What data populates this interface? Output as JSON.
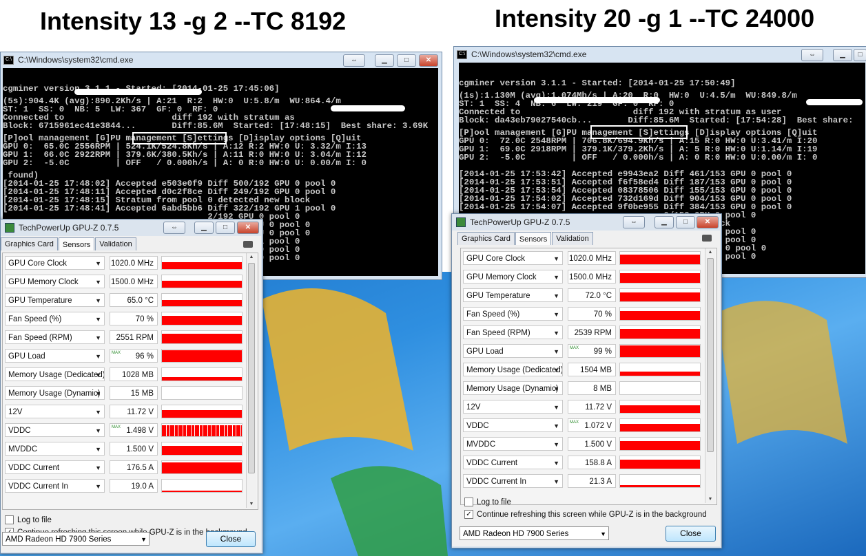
{
  "headings": {
    "left": "Intensity 13 -g 2 --TC 8192",
    "right": "Intensity 20 -g 1 --TC 24000"
  },
  "colors": {
    "graph_red": "#ff0000",
    "console_bg": "#000000",
    "console_text": "#c8c8c8"
  },
  "left_cmd": {
    "title": "C:\\Windows\\system32\\cmd.exe",
    "lines": [
      "cgminer version 3.1.1 - Started: [2014-01-25 17:45:06]",
      "",
      "(5s):904.4K (avg):890.2Kh/s | A:21  R:2  HW:0  U:5.8/m  WU:864.4/m",
      "ST: 1  SS: 0  NB: 5  LW: 367  GF: 0  RF: 0",
      "Connected to                     diff 192 with stratum as",
      "Block: 6715961ec41e3844...       Diff:85.6M  Started: [17:48:15]  Best share: 3.69K",
      "",
      "[P]ool management [G]PU management [S]ettings [D]isplay options [Q]uit",
      "GPU 0:  65.0C 2556RPM | 524.1K/524.8Kh/s | A:12 R:2 HW:0 U: 3.32/m I:13",
      "GPU 1:  66.0C 2922RPM | 379.6K/380.5Kh/s | A:11 R:0 HW:0 U: 3.04/m I:12",
      "GPU 2:  -5.0C         | OFF   / 0.000h/s | A: 0 R:0 HW:0 U: 0.00/m I: 0",
      "",
      " found)",
      "[2014-01-25 17:48:02] Accepted e503e0f9 Diff 500/192 GPU 0 pool 0",
      "[2014-01-25 17:48:11] Accepted d0c2f8ce Diff 249/192 GPU 0 pool 0",
      "[2014-01-25 17:48:15] Stratum from pool 0 detected new block",
      "[2014-01-25 17:48:41] Accepted 6abd5bb6 Diff 322/192 GPU 1 pool 0",
      "                                        2/192 GPU 0 pool 0",
      "                                        69K/192 GPU 0 pool 0",
      "                                        97K/192 GPU 0 pool 0",
      "                                        8/192 GPU 1 pool 0",
      "                                        8/192 GPU 0 pool 0",
      "                                        4/192 GPU 0 pool 0"
    ]
  },
  "right_cmd": {
    "title": "C:\\Windows\\system32\\cmd.exe",
    "lines": [
      "cgminer version 3.1.1 - Started: [2014-01-25 17:50:49]",
      "",
      "(1s):1.130M (avg):1.074Mh/s | A:20  R:0  HW:0  U:4.5/m  WU:849.8/m",
      "ST: 1  SS: 4  NB: 6  LW: 219  GF: 0  RF: 0",
      "Connected to                      diff 192 with stratum as user",
      "Block: da43eb79027540cb...       Diff:85.6M  Started: [17:54:28]  Best share:",
      "",
      "[P]ool management [G]PU management [S]ettings [D]isplay options [Q]uit",
      "GPU 0:  72.0C 2548RPM | 706.8K/694.9Kh/s | A:15 R:0 HW:0 U:3.41/m I:20",
      "GPU 1:  69.0C 2918RPM | 379.1K/379.2Kh/s | A: 5 R:0 HW:0 U:1.14/m I:19",
      "GPU 2:  -5.0C         | OFF   / 0.000h/s | A: 0 R:0 HW:0 U:0.00/m I: 0",
      "",
      "",
      "[2014-01-25 17:53:42] Accepted e9943ea2 Diff 461/153 GPU 0 pool 0",
      "[2014-01-25 17:53:51] Accepted f6f58ed4 Diff 187/153 GPU 0 pool 0",
      "[2014-01-25 17:53:54] Accepted 08378506 Diff 155/153 GPU 0 pool 0",
      "[2014-01-25 17:54:02] Accepted 732d169d Diff 904/153 GPU 0 pool 0",
      "[2014-01-25 17:54:07] Accepted 9f0be955 Diff 384/153 GPU 0 pool 0",
      "                                        0/153 GPU 0 pool 0",
      "                                        ted new block",
      "                                        6/153 GPU 0 pool 0",
      "                                        8/153 GPU 0 pool 0",
      "                                        38K/192 GPU 0 pool 0",
      "                                        0/192 GPU 0 pool 0"
    ]
  },
  "left_gpuz": {
    "title": "TechPowerUp GPU-Z 0.7.5",
    "tabs": [
      "Graphics Card",
      "Sensors",
      "Validation"
    ],
    "sensors": [
      {
        "name": "GPU Core Clock",
        "value": "1020.0 MHz",
        "max": "",
        "level": 0.55
      },
      {
        "name": "GPU Memory Clock",
        "value": "1500.0 MHz",
        "max": "",
        "level": 0.55
      },
      {
        "name": "GPU Temperature",
        "value": "65.0 °C",
        "max": "",
        "level": 0.5
      },
      {
        "name": "Fan Speed (%)",
        "value": "70 %",
        "max": "",
        "level": 0.7
      },
      {
        "name": "Fan Speed (RPM)",
        "value": "2551 RPM",
        "max": "",
        "level": 0.8
      },
      {
        "name": "GPU Load",
        "value": "96 %",
        "max": "MAX",
        "level": 0.95
      },
      {
        "name": "Memory Usage (Dedicated)",
        "value": "1028 MB",
        "max": "",
        "level": 0.3
      },
      {
        "name": "Memory Usage (Dynamic)",
        "value": "15 MB",
        "max": "",
        "level": 0
      },
      {
        "name": "12V",
        "value": "11.72 V",
        "max": "",
        "level": 0.6
      },
      {
        "name": "VDDC",
        "value": "1.498 V",
        "max": "MAX",
        "level": 0.9
      },
      {
        "name": "MVDDC",
        "value": "1.500 V",
        "max": "",
        "level": 0.7
      },
      {
        "name": "VDDC Current",
        "value": "176.5 A",
        "max": "",
        "level": 0.9
      },
      {
        "name": "VDDC Current In",
        "value": "19.0 A",
        "max": "",
        "level": 0.1
      }
    ],
    "log_label": "Log to file",
    "refresh_label": "Continue refreshing this screen while GPU-Z is in the background",
    "device": "AMD Radeon HD 7900 Series",
    "close_label": "Close"
  },
  "right_gpuz": {
    "title": "TechPowerUp GPU-Z 0.7.5",
    "tabs": [
      "Graphics Card",
      "Sensors",
      "Validation"
    ],
    "sensors": [
      {
        "name": "GPU Core Clock",
        "value": "1020.0 MHz",
        "max": "",
        "level": 0.8
      },
      {
        "name": "GPU Memory Clock",
        "value": "1500.0 MHz",
        "max": "",
        "level": 0.8
      },
      {
        "name": "GPU Temperature",
        "value": "72.0 °C",
        "max": "",
        "level": 0.75
      },
      {
        "name": "Fan Speed (%)",
        "value": "70 %",
        "max": "",
        "level": 0.7
      },
      {
        "name": "Fan Speed (RPM)",
        "value": "2539 RPM",
        "max": "",
        "level": 0.8
      },
      {
        "name": "GPU Load",
        "value": "99 %",
        "max": "MAX",
        "level": 0.95
      },
      {
        "name": "Memory Usage (Dedicated)",
        "value": "1504 MB",
        "max": "",
        "level": 0.35
      },
      {
        "name": "Memory Usage (Dynamic)",
        "value": "8 MB",
        "max": "",
        "level": 0
      },
      {
        "name": "12V",
        "value": "11.72 V",
        "max": "",
        "level": 0.6
      },
      {
        "name": "VDDC",
        "value": "1.072 V",
        "max": "MAX",
        "level": 0.6
      },
      {
        "name": "MVDDC",
        "value": "1.500 V",
        "max": "",
        "level": 0.7
      },
      {
        "name": "VDDC Current",
        "value": "158.8 A",
        "max": "",
        "level": 0.7
      },
      {
        "name": "VDDC Current In",
        "value": "21.3 A",
        "max": "",
        "level": 0.15
      }
    ],
    "log_label": "Log to file",
    "refresh_label": "Continue refreshing this screen while GPU-Z is in the background",
    "device": "AMD Radeon HD 7900 Series",
    "close_label": "Close"
  }
}
